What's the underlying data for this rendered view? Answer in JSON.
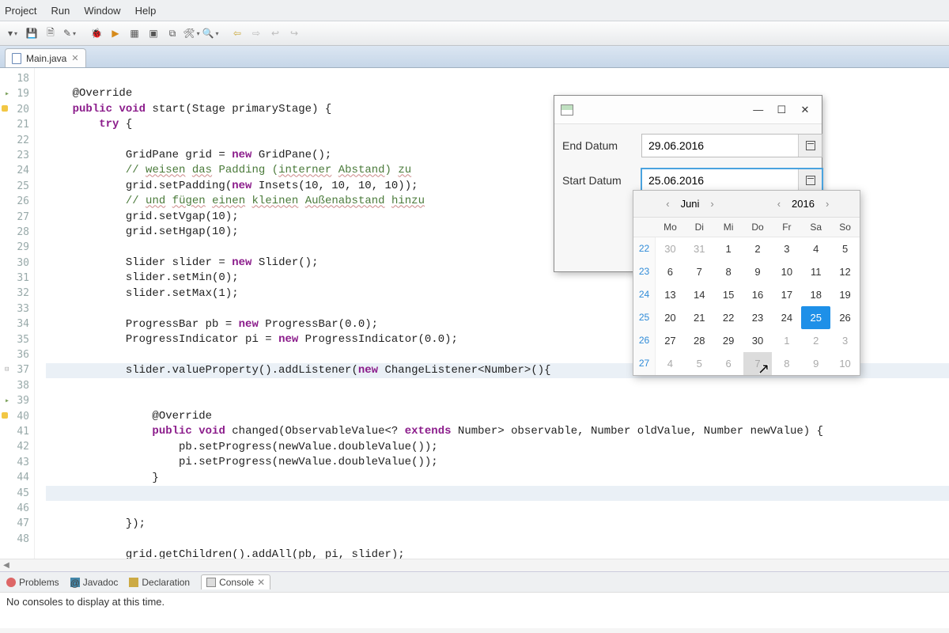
{
  "menu": {
    "items": [
      "Project",
      "Run",
      "Window",
      "Help"
    ]
  },
  "tab": {
    "filename": "Main.java"
  },
  "gutter": {
    "lines": [
      {
        "n": "18"
      },
      {
        "n": "19",
        "mark": "override"
      },
      {
        "n": "20",
        "mark": "warn"
      },
      {
        "n": "21"
      },
      {
        "n": "22"
      },
      {
        "n": "23"
      },
      {
        "n": "24"
      },
      {
        "n": "25"
      },
      {
        "n": "26"
      },
      {
        "n": "27"
      },
      {
        "n": "28"
      },
      {
        "n": "29"
      },
      {
        "n": "30"
      },
      {
        "n": "31"
      },
      {
        "n": "32"
      },
      {
        "n": "33"
      },
      {
        "n": "34"
      },
      {
        "n": "35"
      },
      {
        "n": "36"
      },
      {
        "n": "37",
        "mark": "section"
      },
      {
        "n": "38"
      },
      {
        "n": "39",
        "mark": "override"
      },
      {
        "n": "40",
        "mark": "warn"
      },
      {
        "n": "41"
      },
      {
        "n": "42"
      },
      {
        "n": "43"
      },
      {
        "n": "44"
      },
      {
        "n": "45"
      },
      {
        "n": "46"
      },
      {
        "n": "47"
      },
      {
        "n": "48"
      }
    ]
  },
  "views": {
    "problems": "Problems",
    "javadoc": "Javadoc",
    "declaration": "Declaration",
    "console": "Console"
  },
  "console_msg": "No consoles to display at this time.",
  "dialog": {
    "end_label": "End Datum",
    "end_value": "29.06.2016",
    "start_label": "Start Datum",
    "start_value": "25.06.2016"
  },
  "datepicker": {
    "month": "Juni",
    "year": "2016",
    "dow": [
      "",
      "Mo",
      "Di",
      "Mi",
      "Do",
      "Fr",
      "Sa",
      "So"
    ],
    "rows": [
      {
        "wk": "22",
        "d": [
          "30",
          "31",
          "1",
          "2",
          "3",
          "4",
          "5"
        ],
        "other": [
          0,
          1
        ]
      },
      {
        "wk": "23",
        "d": [
          "6",
          "7",
          "8",
          "9",
          "10",
          "11",
          "12"
        ],
        "other": []
      },
      {
        "wk": "24",
        "d": [
          "13",
          "14",
          "15",
          "16",
          "17",
          "18",
          "19"
        ],
        "other": []
      },
      {
        "wk": "25",
        "d": [
          "20",
          "21",
          "22",
          "23",
          "24",
          "25",
          "26"
        ],
        "other": [],
        "sel": 5
      },
      {
        "wk": "26",
        "d": [
          "27",
          "28",
          "29",
          "30",
          "1",
          "2",
          "3"
        ],
        "other": [
          4,
          5,
          6
        ]
      },
      {
        "wk": "27",
        "d": [
          "4",
          "5",
          "6",
          "7",
          "8",
          "9",
          "10"
        ],
        "other": [
          0,
          1,
          2,
          3,
          4,
          5,
          6
        ],
        "hov": 3
      }
    ]
  }
}
